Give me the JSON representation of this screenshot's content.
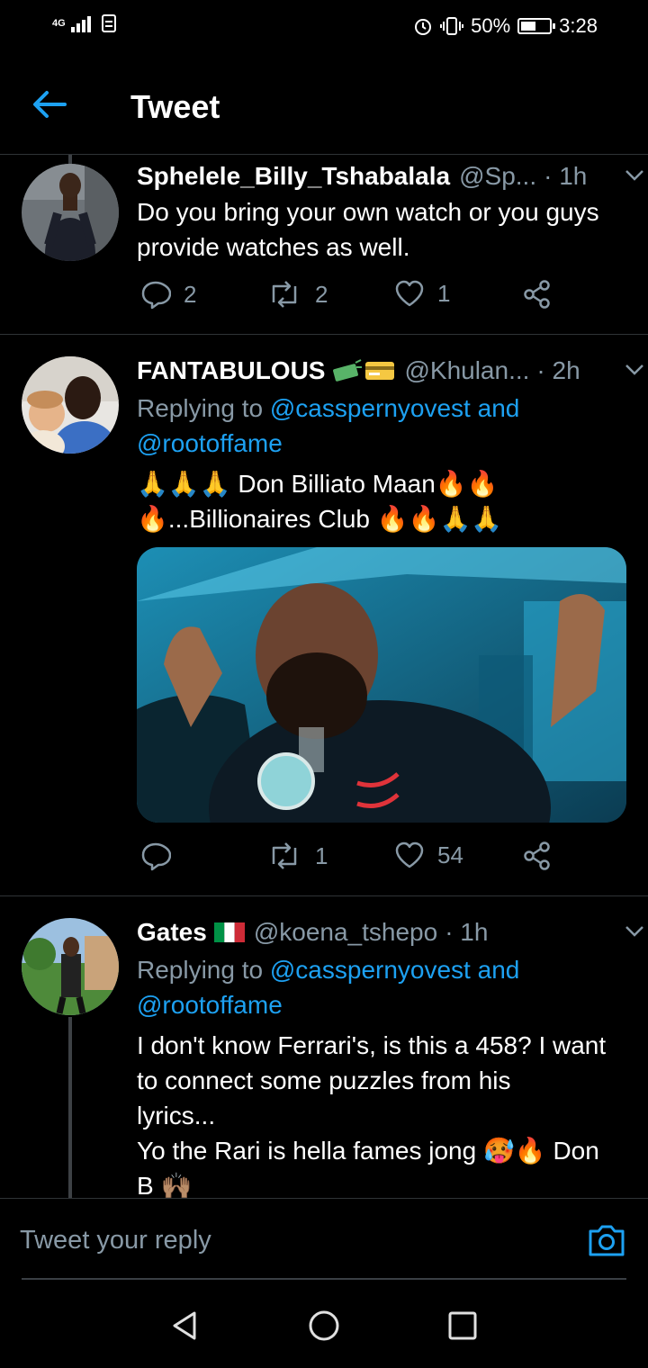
{
  "status_bar": {
    "network": "4G",
    "battery": "50%",
    "time": "3:28"
  },
  "header": {
    "title": "Tweet"
  },
  "tweets": [
    {
      "name": "Sphelele_Billy_Tshabalala",
      "handle": "@Sp...",
      "time": "· 1h",
      "text_lines": [
        "Do you bring your own watch or you guys",
        "provide watches as well."
      ],
      "replies": "2",
      "retweets": "2",
      "likes": "1"
    },
    {
      "name": "FANTABULOUS",
      "handle": "@Khulan...",
      "time": "· 2h",
      "replying_prefix": "Replying to ",
      "replying_user1": "@casspernyovest",
      "replying_and": " and",
      "replying_user2": "@rootoffame",
      "text_line1": "🙏🙏🙏 Don Billiato Maan🔥🔥",
      "text_line2": "🔥...Billionaires Club 🔥🔥🙏🙏",
      "retweets": "1",
      "likes": "54"
    },
    {
      "name": "Gates",
      "handle": "@koena_tshepo",
      "time": "· 1h",
      "replying_prefix": "Replying to ",
      "replying_user1": "@casspernyovest",
      "replying_and": " and",
      "replying_user2": "@rootoffame",
      "text_lines": [
        "I don't know Ferrari's, is this a 458? I want",
        "to connect some puzzles from his",
        "lyrics...",
        "Yo the Rari is hella fames jong 🥵🔥 Don",
        "B 🙌🏽"
      ]
    }
  ],
  "reply_bar": {
    "placeholder": "Tweet your reply"
  },
  "colors": {
    "accent": "#1da1f2",
    "muted": "#8899a6",
    "background": "#000000"
  }
}
